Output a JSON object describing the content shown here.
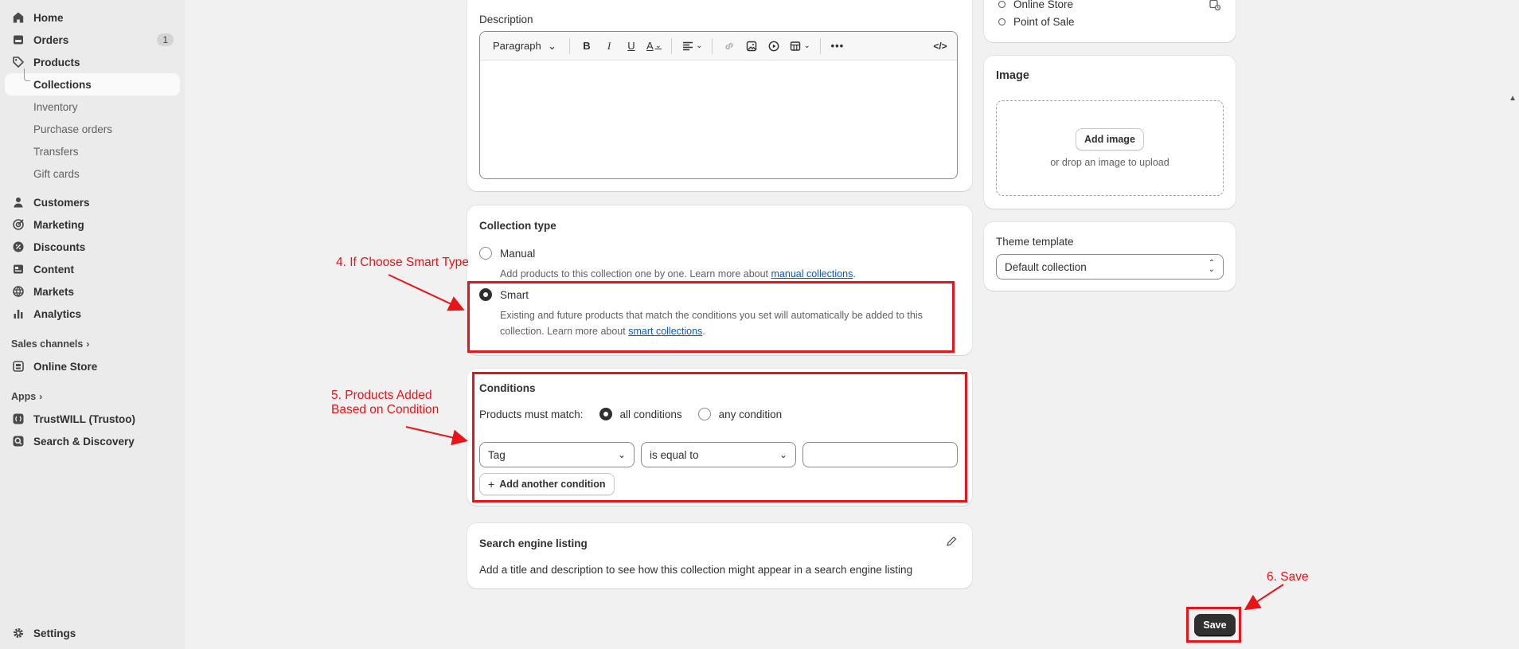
{
  "sidebar": {
    "items": [
      {
        "label": "Home",
        "icon": "home-icon"
      },
      {
        "label": "Orders",
        "icon": "orders-icon",
        "badge": "1"
      },
      {
        "label": "Products",
        "icon": "tag-icon"
      }
    ],
    "product_sub": [
      "Collections",
      "Inventory",
      "Purchase orders",
      "Transfers",
      "Gift cards"
    ],
    "items2": [
      {
        "label": "Customers",
        "icon": "person-icon"
      },
      {
        "label": "Marketing",
        "icon": "target-icon"
      },
      {
        "label": "Discounts",
        "icon": "discount-icon"
      },
      {
        "label": "Content",
        "icon": "content-icon"
      },
      {
        "label": "Markets",
        "icon": "globe-icon"
      },
      {
        "label": "Analytics",
        "icon": "bar-chart-icon"
      }
    ],
    "sales_channels_label": "Sales channels",
    "online_store": "Online Store",
    "apps_label": "Apps",
    "apps": [
      "TrustWILL (Trustoo)",
      "Search & Discovery"
    ],
    "settings": "Settings"
  },
  "description": {
    "label": "Description",
    "paragraph": "Paragraph"
  },
  "collection_type": {
    "title": "Collection type",
    "manual_label": "Manual",
    "manual_desc": "Add products to this collection one by one. Learn more about ",
    "manual_link": "manual collections",
    "smart_label": "Smart",
    "smart_desc_1": "Existing and future products that match the conditions you set will automatically be added to this",
    "smart_desc_2": "collection. Learn more about ",
    "smart_link": "smart collections",
    "period": "."
  },
  "conditions": {
    "title": "Conditions",
    "match_label": "Products must match:",
    "all_label": "all conditions",
    "any_label": "any condition",
    "field": "Tag",
    "operator": "is equal to",
    "value": "",
    "add_button": "Add another condition"
  },
  "seo": {
    "title": "Search engine listing",
    "desc": "Add a title and description to see how this collection might appear in a search engine listing"
  },
  "channels": [
    "Online Store",
    "Point of Sale"
  ],
  "image": {
    "title": "Image",
    "add_button": "Add image",
    "hint": "or drop an image to upload"
  },
  "theme": {
    "label": "Theme template",
    "value": "Default collection"
  },
  "save_label": "Save",
  "annotations": {
    "a4": "4. If Choose Smart Type",
    "a5_1": "5. Products Added",
    "a5_2": "Based on Condition",
    "a6": "6. Save",
    "color": "#e8141a"
  },
  "colors": {
    "primary": "#303030",
    "link": "#005bd3",
    "background": "#f1f1f1",
    "sidebar": "#ebebeb"
  }
}
